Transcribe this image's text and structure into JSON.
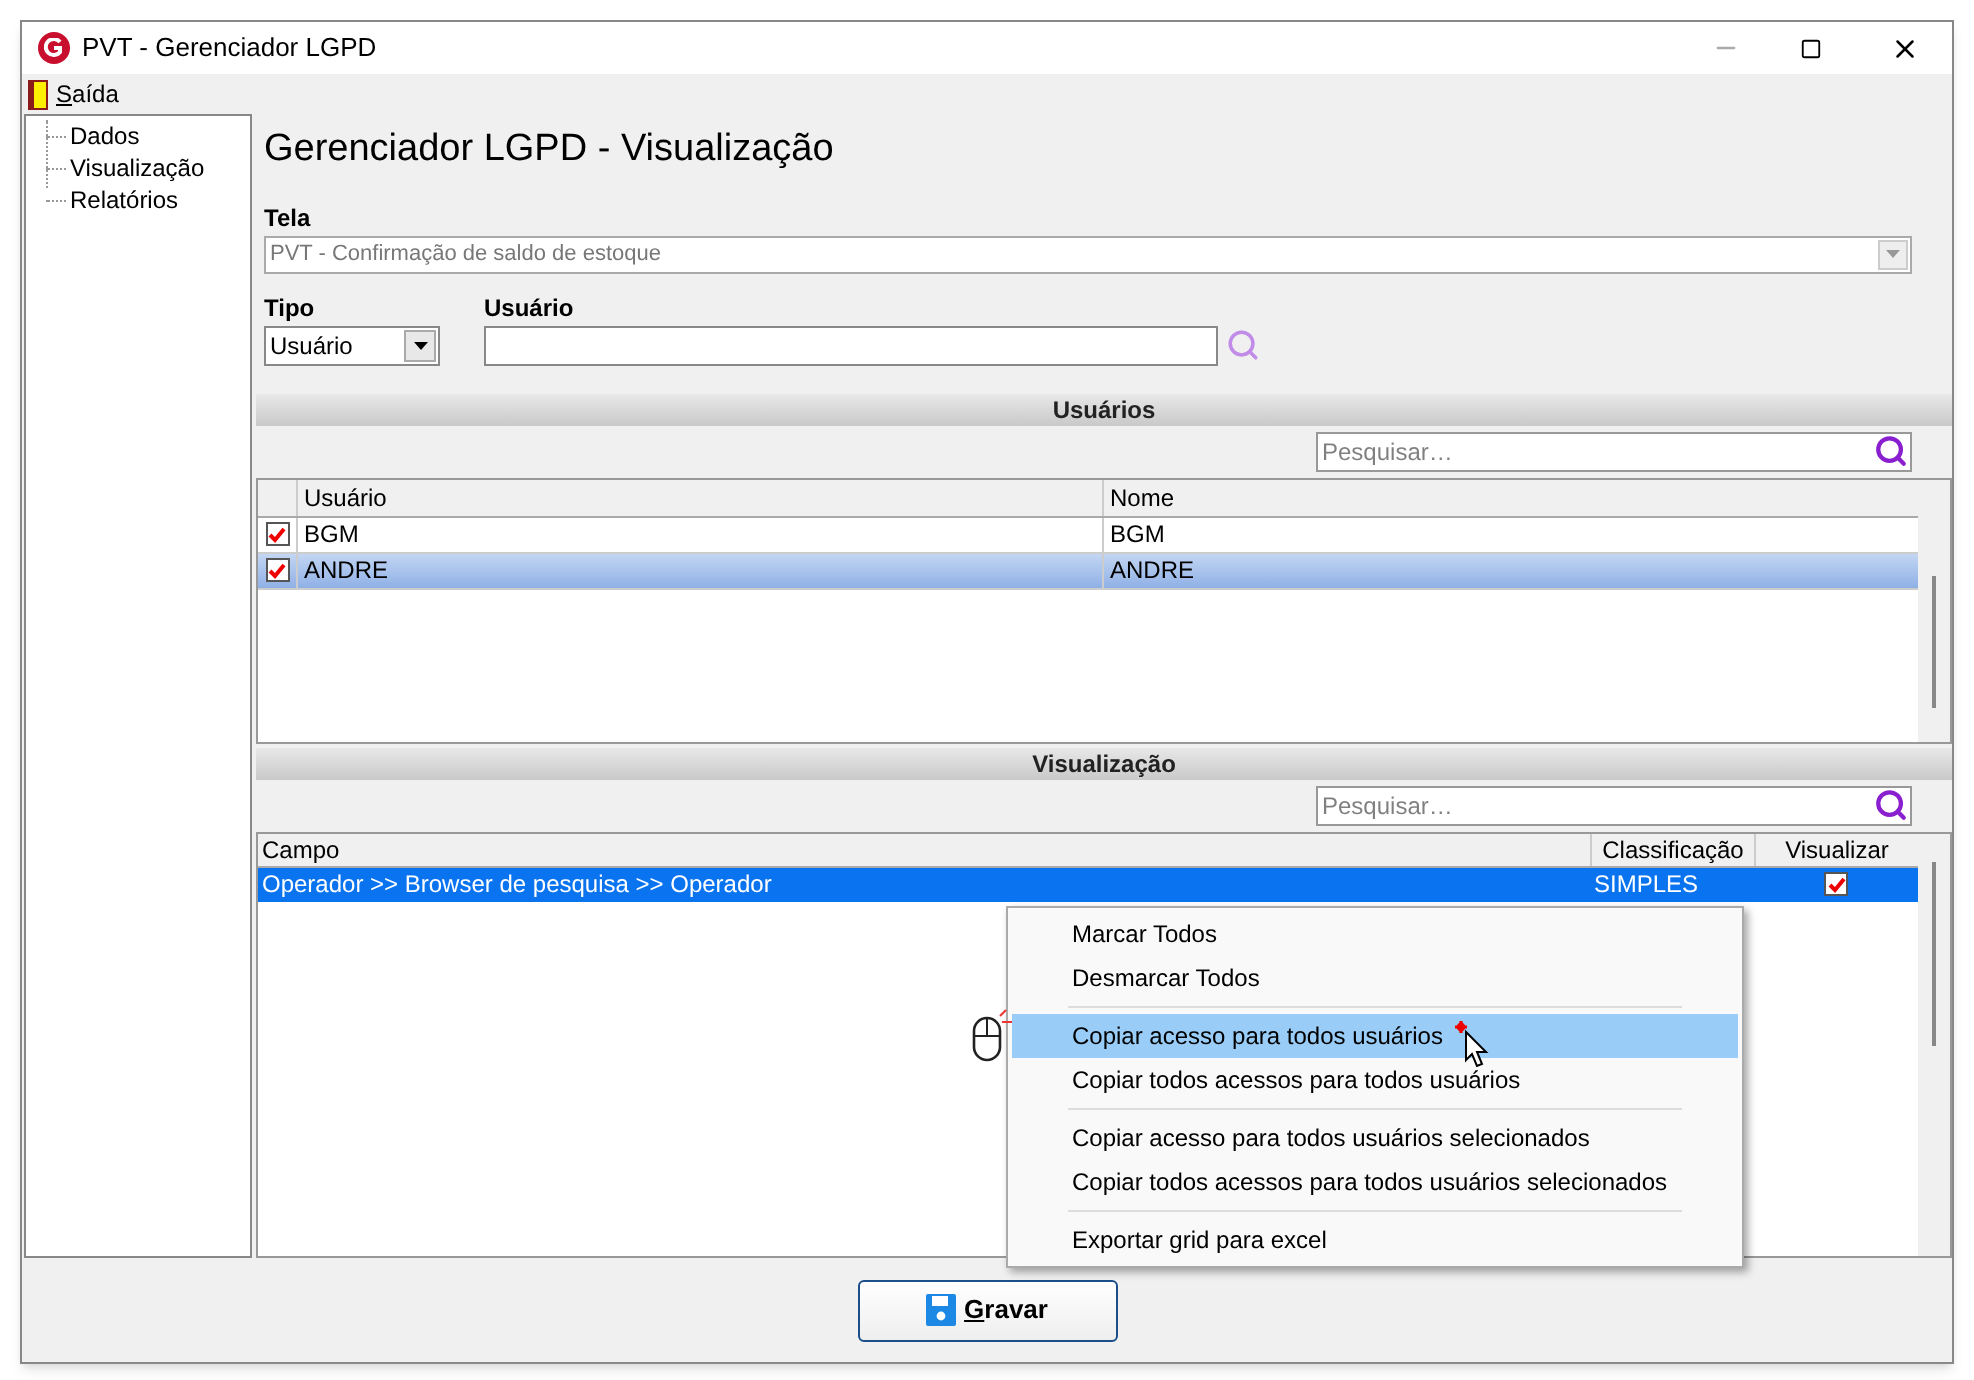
{
  "window": {
    "title": "PVT - Gerenciador LGPD"
  },
  "menu": [
    {
      "label": "Saída"
    }
  ],
  "sidebar": {
    "items": [
      {
        "label": "Dados"
      },
      {
        "label": "Visualização"
      },
      {
        "label": "Relatórios"
      }
    ]
  },
  "heading": "Gerenciador LGPD - Visualização",
  "tela": {
    "label": "Tela",
    "value": "PVT - Confirmação de saldo de estoque",
    "disabled": true
  },
  "tipo": {
    "label": "Tipo",
    "value": "Usuário"
  },
  "usuario": {
    "label": "Usuário"
  },
  "usuarios": {
    "title": "Usuários",
    "search": {
      "placeholder": "Pesquisar…"
    },
    "columns": [
      "Usuário",
      "Nome"
    ],
    "rows": [
      {
        "checked": true,
        "selected": false,
        "cells": [
          "BGM",
          "BGM"
        ]
      },
      {
        "checked": true,
        "selected": true,
        "cells": [
          "ANDRE",
          "ANDRE"
        ]
      }
    ]
  },
  "visualizacao": {
    "title": "Visualização",
    "search": {
      "placeholder": "Pesquisar…"
    },
    "columns": [
      "Campo",
      "Classificação",
      "Visualizar"
    ],
    "rows": [
      {
        "selected": true,
        "campo": "Operador >> Browser de pesquisa >> Operador",
        "classificacao": "SIMPLES",
        "visualizar": true
      }
    ]
  },
  "context_menu": [
    {
      "kind": "item",
      "label": "Marcar Todos",
      "selected": false
    },
    {
      "kind": "item",
      "label": "Desmarcar Todos",
      "selected": false
    },
    {
      "kind": "separator"
    },
    {
      "kind": "item",
      "label": "Copiar acesso para todos usuários",
      "selected": true
    },
    {
      "kind": "item",
      "label": "Copiar todos acessos para todos usuários",
      "selected": false
    },
    {
      "kind": "separator"
    },
    {
      "kind": "item",
      "label": "Copiar acesso para todos usuários selecionados",
      "selected": false
    },
    {
      "kind": "item",
      "label": "Copiar todos acessos para todos usuários selecionados",
      "selected": false
    },
    {
      "kind": "separator"
    },
    {
      "kind": "item",
      "label": "Exportar grid para excel",
      "selected": false
    }
  ],
  "save_button": {
    "label": "Gravar"
  }
}
